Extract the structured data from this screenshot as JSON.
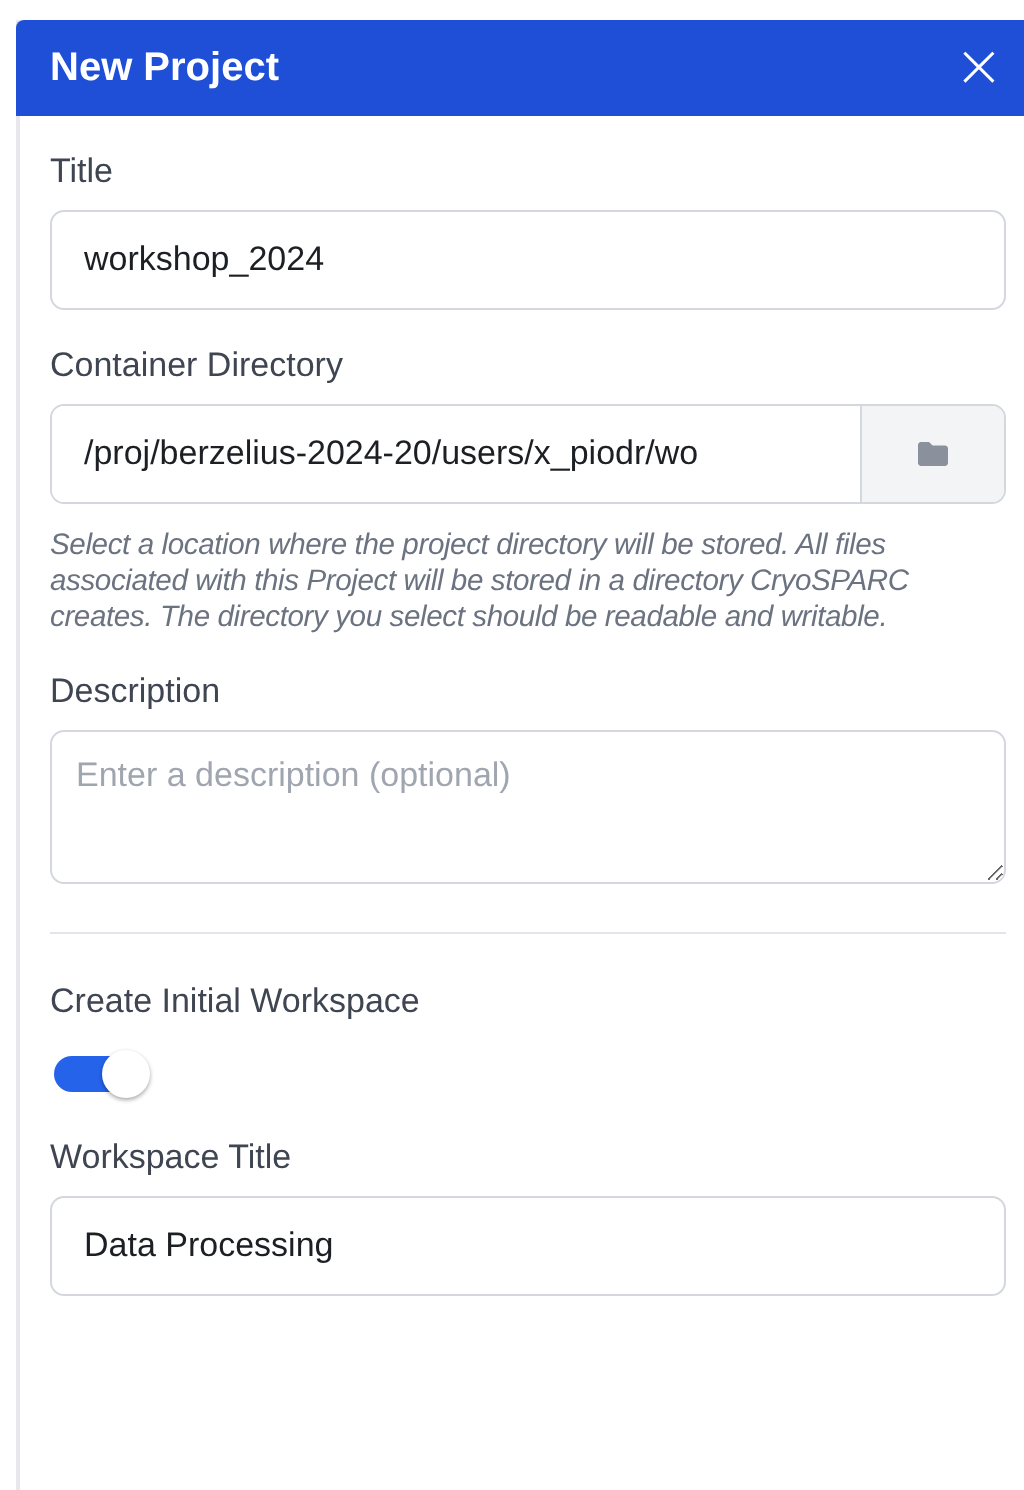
{
  "dialog": {
    "title": "New Project",
    "close": "×"
  },
  "fields": [
    {
      "kind": "text",
      "label": "Title",
      "value": "workshop_2024"
    },
    {
      "kind": "folder",
      "label": "Container Directory",
      "value": "/proj/berzelius-2024-20/users/x_piodr/wo",
      "help": "Select a location where the project directory will be stored. All files associated with this Project will be stored in a directory CryoSPARC creates. The directory you select should be readable and writable."
    },
    {
      "kind": "textarea",
      "label": "Description",
      "placeholder": "Enter a description (optional)"
    },
    {
      "kind": "divider"
    },
    {
      "kind": "toggle",
      "label": "Create Initial Workspace",
      "on": true
    },
    {
      "kind": "text",
      "label": "Workspace Title",
      "value": "Data Processing"
    }
  ]
}
